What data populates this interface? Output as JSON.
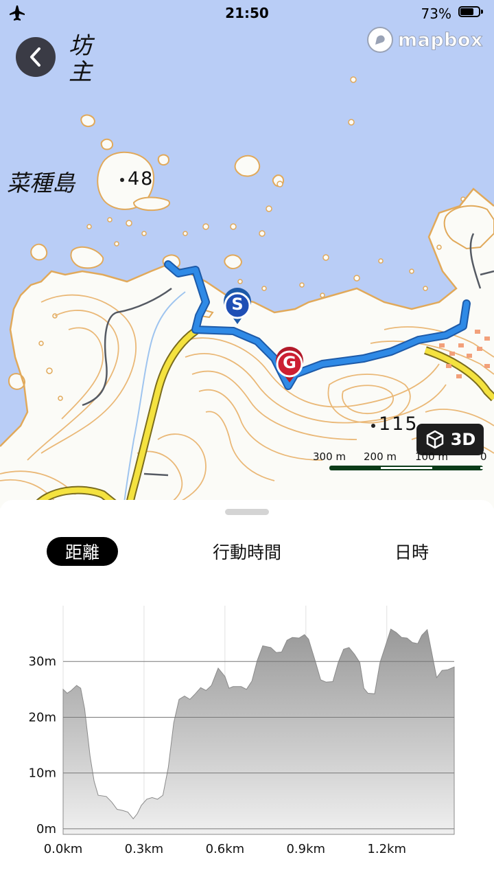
{
  "status_bar": {
    "time": "21:50",
    "battery_percent": "73%",
    "battery_level": 0.73
  },
  "map": {
    "brand": "mapbox",
    "place_labels": [
      "坊主",
      "菜種島"
    ],
    "elevation_labels": [
      "48",
      "115"
    ],
    "start_marker": "S",
    "goal_marker": "G",
    "view_mode_button": "3D",
    "scale": {
      "labels": [
        "300 m",
        "200 m",
        "100 m",
        "0"
      ]
    },
    "colors": {
      "sea": "#b7cdf5",
      "land": "#ffffff",
      "contour": "#e8b36a",
      "route": "#2979d8",
      "road": "#f0dc3a"
    }
  },
  "sheet": {
    "tabs": [
      {
        "label": "距離",
        "active": true
      },
      {
        "label": "行動時間",
        "active": false
      },
      {
        "label": "日時",
        "active": false
      }
    ]
  },
  "chart_data": {
    "type": "area",
    "xlabel": "",
    "ylabel": "",
    "x_ticks": [
      "0.0km",
      "0.3km",
      "0.6km",
      "0.9km",
      "1.2km"
    ],
    "y_ticks": [
      "0m",
      "10m",
      "20m",
      "30m"
    ],
    "xlim": [
      0,
      1.45
    ],
    "ylim": [
      -1,
      40
    ],
    "grid": true,
    "x": [
      0,
      0.015,
      0.03,
      0.05,
      0.065,
      0.08,
      0.1,
      0.115,
      0.13,
      0.16,
      0.18,
      0.2,
      0.22,
      0.24,
      0.26,
      0.275,
      0.29,
      0.31,
      0.33,
      0.35,
      0.37,
      0.39,
      0.41,
      0.43,
      0.45,
      0.47,
      0.49,
      0.51,
      0.53,
      0.55,
      0.575,
      0.6,
      0.615,
      0.63,
      0.66,
      0.68,
      0.7,
      0.72,
      0.74,
      0.77,
      0.79,
      0.81,
      0.83,
      0.85,
      0.875,
      0.895,
      0.91,
      0.935,
      0.955,
      0.975,
      1.0,
      1.02,
      1.04,
      1.06,
      1.08,
      1.1,
      1.115,
      1.13,
      1.155,
      1.175,
      1.195,
      1.215,
      1.235,
      1.255,
      1.275,
      1.295,
      1.315,
      1.33,
      1.35,
      1.365,
      1.385,
      1.405,
      1.425,
      1.45
    ],
    "values": [
      25,
      24.3,
      24.8,
      25.7,
      25.2,
      21.5,
      13,
      8.5,
      6,
      5.8,
      4.8,
      3.5,
      3.3,
      3.0,
      1.8,
      2.7,
      4.2,
      5.3,
      5.6,
      5.3,
      6,
      11,
      19,
      23.2,
      23.8,
      23.2,
      24.2,
      25.3,
      24.8,
      25.7,
      28.8,
      27.3,
      25.2,
      25.5,
      25.5,
      25,
      26.5,
      30.2,
      32.8,
      32.5,
      31.6,
      31.7,
      33.8,
      34.3,
      34.2,
      34.8,
      34,
      30,
      26.7,
      26.3,
      26.4,
      29.8,
      32.2,
      32.5,
      31.3,
      29.8,
      25.2,
      24.3,
      24.2,
      29.8,
      32.8,
      35.8,
      35.2,
      34.3,
      34.2,
      33.4,
      33.2,
      34.7,
      35.7,
      32,
      27.1,
      28.4,
      28.5,
      29
    ]
  }
}
